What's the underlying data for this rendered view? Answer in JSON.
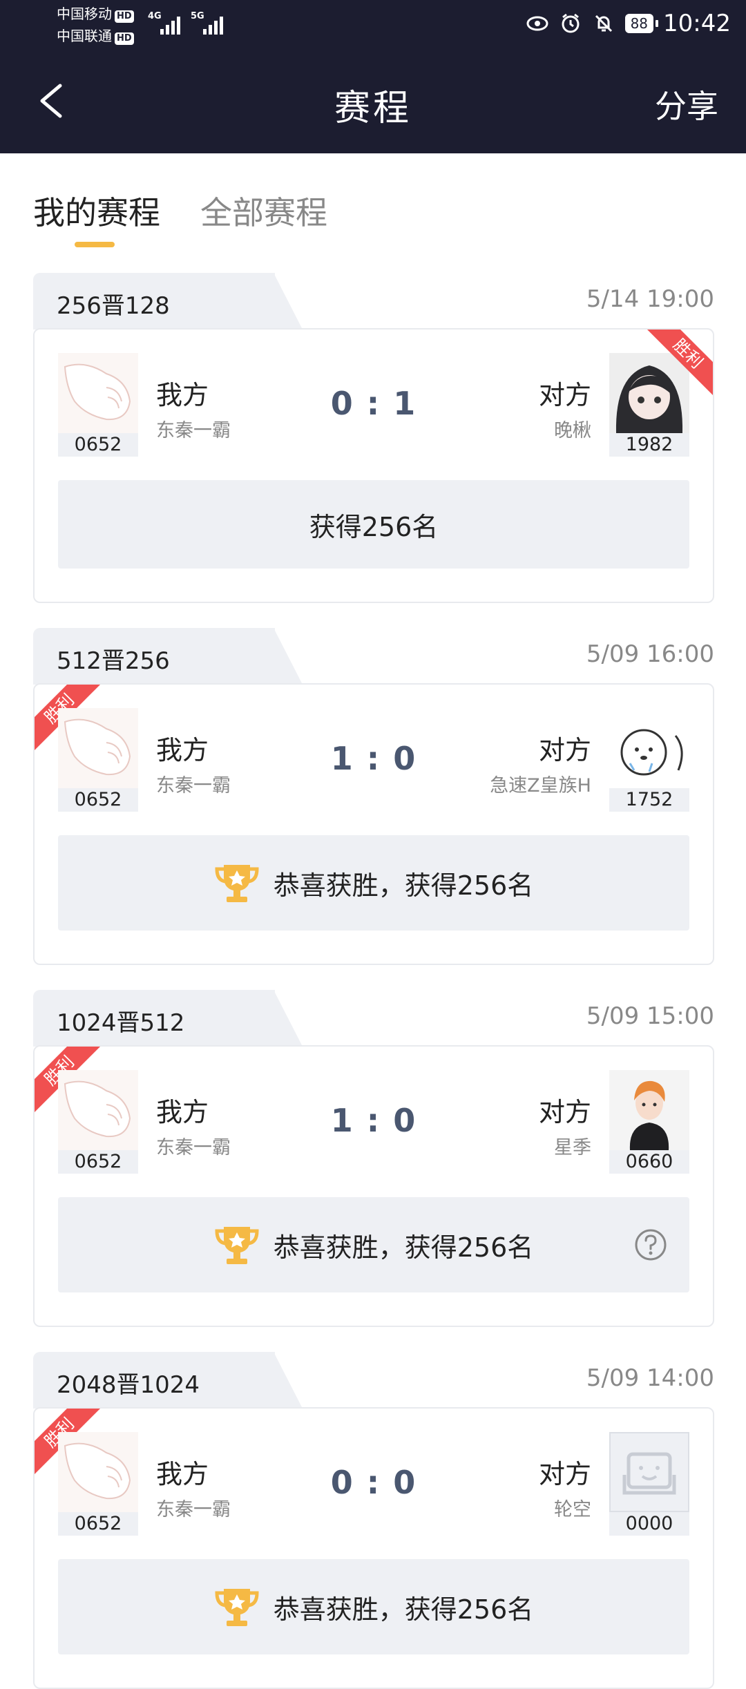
{
  "status_bar": {
    "carrier1": "中国移动",
    "carrier2": "中国联通",
    "hd": "HD",
    "net1": "4G",
    "net2": "5G",
    "battery": "88",
    "time": "10:42"
  },
  "nav": {
    "title": "赛程",
    "share": "分享"
  },
  "tabs": {
    "mine": "我的赛程",
    "all": "全部赛程"
  },
  "matches": [
    {
      "round": "256晋128",
      "time": "5/14 19:00",
      "left": {
        "label": "我方",
        "name": "东秦一霸",
        "id": "0652"
      },
      "right": {
        "label": "对方",
        "name": "晚楸",
        "id": "1982"
      },
      "score": "0 : 1",
      "ribbon": "胜利",
      "result": "获得256名"
    },
    {
      "round": "512晋256",
      "time": "5/09 16:00",
      "left": {
        "label": "我方",
        "name": "东秦一霸",
        "id": "0652"
      },
      "right": {
        "label": "对方",
        "name": "急速Z皇族H",
        "id": "1752"
      },
      "score": "1 : 0",
      "ribbon": "胜利",
      "result": "恭喜获胜，获得256名"
    },
    {
      "round": "1024晋512",
      "time": "5/09 15:00",
      "left": {
        "label": "我方",
        "name": "东秦一霸",
        "id": "0652"
      },
      "right": {
        "label": "对方",
        "name": "星季",
        "id": "0660"
      },
      "score": "1 : 0",
      "ribbon": "胜利",
      "result": "恭喜获胜，获得256名"
    },
    {
      "round": "2048晋1024",
      "time": "5/09 14:00",
      "left": {
        "label": "我方",
        "name": "东秦一霸",
        "id": "0652"
      },
      "right": {
        "label": "对方",
        "name": "轮空",
        "id": "0000"
      },
      "score": "0 : 0",
      "ribbon": "胜利",
      "result": "恭喜获胜，获得256名"
    }
  ],
  "colors": {
    "header_bg": "#1c1d30",
    "accent": "#f5b944",
    "win_ribbon": "#f05050",
    "score_text": "#4a5770"
  }
}
